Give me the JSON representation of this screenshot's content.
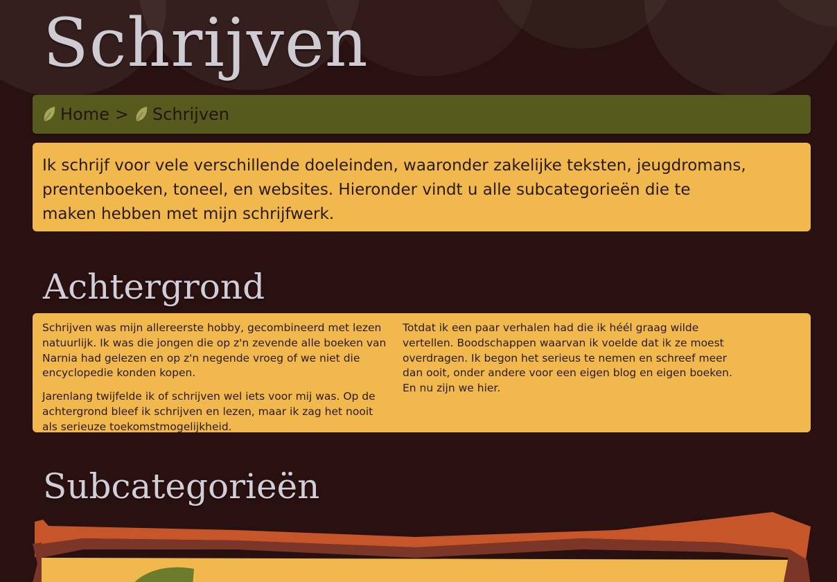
{
  "page": {
    "title": "Schrijven"
  },
  "breadcrumb": {
    "items": [
      {
        "label": "Home",
        "icon": "leaf-icon"
      },
      {
        "label": "Schrijven",
        "icon": "leaf-icon"
      }
    ],
    "separator": ">"
  },
  "intro": {
    "text": "Ik schrijf voor vele verschillende doeleinden, waaronder zakelijke teksten, jeugdromans, prentenboeken, toneel, en websites. Hieronder vindt u alle subcategorieën die te maken hebben met mijn schrijfwerk."
  },
  "sections": {
    "background": {
      "heading": "Achtergrond",
      "paragraphs": [
        "Schrijven was mijn allereerste hobby, gecombineerd met lezen natuurlijk. Ik was die jongen die op z'n zevende alle boeken van Narnia had gelezen en op z'n negende vroeg of we niet die encyclopedie konden kopen.",
        "Jarenlang twijfelde ik of schrijven wel iets voor mij was. Op de achtergrond bleef ik schrijven en lezen, maar ik zag het nooit als serieuze toekomstmogelijkheid.",
        "Totdat ik een paar verhalen had die ik héél graag wilde vertellen. Boodschappen waarvan ik voelde dat ik ze moest overdragen. Ik begon het serieus te nemen en schreef meer dan ooit, onder andere voor een eigen blog en eigen boeken. En nu zijn we hier."
      ]
    },
    "subcategories": {
      "heading": "Subcategorieën"
    }
  },
  "colors": {
    "background": "#2a1111",
    "breadcrumb_bg": "#565a1c",
    "panel_bg": "#f1b94d",
    "heading_text": "#cfcbd2",
    "body_text": "#2a1a14",
    "leaf": "#a8a55e",
    "tile_orange": "#c7552a",
    "tile_brown": "#7c3628",
    "tile_green": "#6d7b2c"
  }
}
